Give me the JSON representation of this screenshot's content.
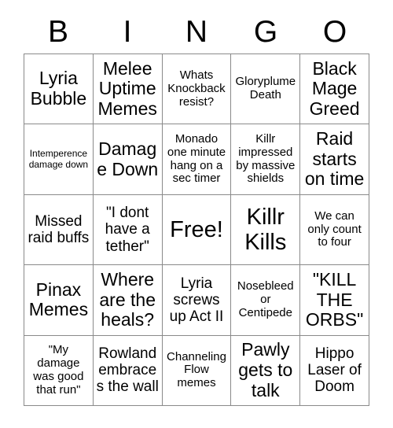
{
  "card": {
    "header_letters": [
      "B",
      "I",
      "N",
      "G",
      "O"
    ],
    "grid": [
      [
        {
          "text": "Lyria Bubble",
          "size": "lg"
        },
        {
          "text": "Melee Uptime Memes",
          "size": "lg"
        },
        {
          "text": "Whats Knockback resist?",
          "size": "sm"
        },
        {
          "text": "Gloryplume Death",
          "size": "sm"
        },
        {
          "text": "Black Mage Greed",
          "size": "lg"
        }
      ],
      [
        {
          "text": "Intemperence damage down",
          "size": "xs"
        },
        {
          "text": "Damage Down",
          "size": "lg"
        },
        {
          "text": "Monado one minute hang on a sec timer",
          "size": "sm"
        },
        {
          "text": "Killr impressed by massive shields",
          "size": "sm"
        },
        {
          "text": "Raid starts on time",
          "size": "lg"
        }
      ],
      [
        {
          "text": "Missed raid buffs",
          "size": "md"
        },
        {
          "text": "\"I dont have a tether\"",
          "size": "md"
        },
        {
          "text": "Free!",
          "size": "xl"
        },
        {
          "text": "Killr Kills",
          "size": "xl"
        },
        {
          "text": "We can only count to four",
          "size": "sm"
        }
      ],
      [
        {
          "text": "Pinax Memes",
          "size": "lg"
        },
        {
          "text": "Where are the heals?",
          "size": "lg"
        },
        {
          "text": "Lyria screws up Act II",
          "size": "md"
        },
        {
          "text": "Nosebleed or Centipede",
          "size": "sm"
        },
        {
          "text": "\"KILL THE ORBS\"",
          "size": "lg"
        }
      ],
      [
        {
          "text": "\"My damage was good that run\"",
          "size": "sm"
        },
        {
          "text": "Rowland embraces the wall",
          "size": "md"
        },
        {
          "text": "Channeling Flow memes",
          "size": "sm"
        },
        {
          "text": "Pawly gets to talk",
          "size": "lg"
        },
        {
          "text": "Hippo Laser of Doom",
          "size": "md"
        }
      ]
    ],
    "colors": {
      "background": "#ffffff",
      "text": "#000000",
      "grid_line": "#8a8a8a"
    }
  }
}
